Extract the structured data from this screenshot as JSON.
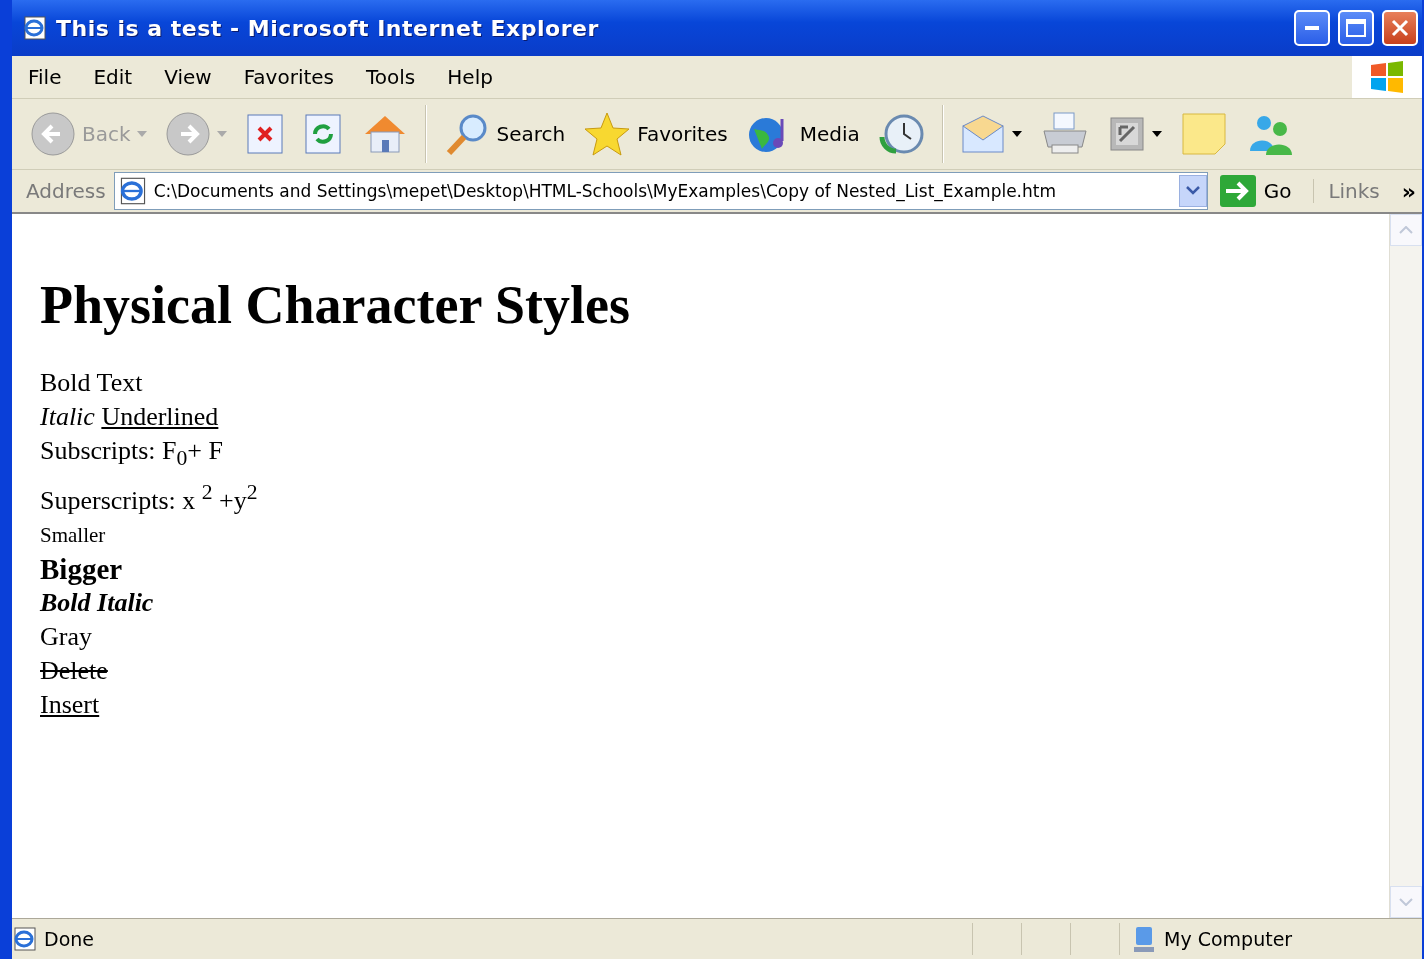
{
  "window": {
    "title": "This is a test - Microsoft Internet Explorer"
  },
  "menu": [
    "File",
    "Edit",
    "View",
    "Favorites",
    "Tools",
    "Help"
  ],
  "toolbar": [
    {
      "kind": "back",
      "label": "Back",
      "disabled": true,
      "dropdown": true
    },
    {
      "kind": "forward",
      "disabled": true,
      "dropdown": true
    },
    {
      "kind": "stop"
    },
    {
      "kind": "refresh"
    },
    {
      "kind": "home"
    },
    {
      "kind": "sep"
    },
    {
      "kind": "search",
      "label": "Search"
    },
    {
      "kind": "favorites",
      "label": "Favorites"
    },
    {
      "kind": "media",
      "label": "Media"
    },
    {
      "kind": "history"
    },
    {
      "kind": "sep"
    },
    {
      "kind": "mail",
      "dropdown": true
    },
    {
      "kind": "print"
    },
    {
      "kind": "edit",
      "dropdown": true
    },
    {
      "kind": "note"
    },
    {
      "kind": "messenger"
    }
  ],
  "address_bar": {
    "label": "Address",
    "value": "C:\\Documents and Settings\\mepet\\Desktop\\HTML-Schools\\MyExamples\\Copy of Nested_List_Example.htm",
    "go": "Go",
    "links": "Links",
    "more": "»"
  },
  "page": {
    "heading": "Physical Character Styles",
    "lines": [
      {
        "kind": "plain",
        "text": "Bold Text"
      },
      {
        "kind": "segments",
        "parts": [
          {
            "kind": "italic",
            "text": "Italic"
          },
          {
            "kind": "underline",
            "text": "Underlined"
          }
        ]
      },
      {
        "kind": "plain",
        "text": "Subscripts: F$_{0}$+ F"
      },
      {
        "kind": "plain",
        "text": "Superscripts: x $^{2}$ +y$^{2}$"
      },
      {
        "kind": "small",
        "text": "Smaller"
      },
      {
        "kind": "big",
        "text": "Bigger"
      },
      {
        "kind": "bold-italic",
        "text": "Bold Italic"
      },
      {
        "kind": "plain",
        "text": "Gray"
      },
      {
        "kind": "strike",
        "text": "Delete"
      },
      {
        "kind": "underline",
        "text": "Insert"
      }
    ]
  },
  "status_bar": {
    "text": "Done",
    "zone": "My Computer"
  }
}
